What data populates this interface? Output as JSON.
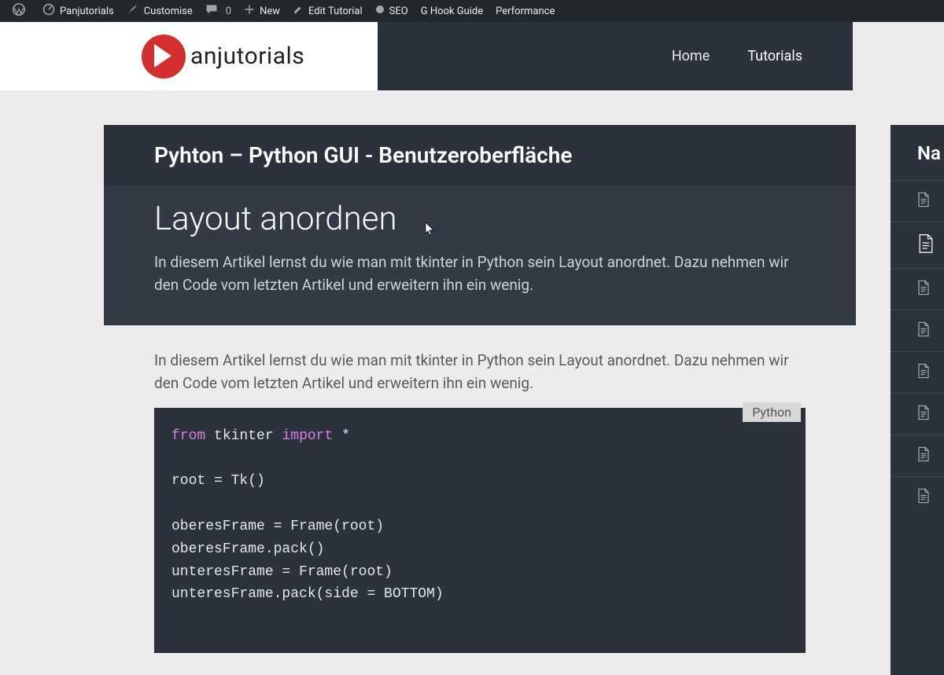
{
  "adminbar": {
    "site": "Panjutorials",
    "customise": "Customise",
    "comments_count": "0",
    "new": "New",
    "edit_tutorial": "Edit Tutorial",
    "seo": "SEO",
    "hook_guide": "G Hook Guide",
    "performance": "Performance"
  },
  "brand": {
    "word": "anjutorials"
  },
  "nav": {
    "home": "Home",
    "tutorials": "Tutorials"
  },
  "course": {
    "title": "Pyhton – Python GUI - Benutzeroberfläche"
  },
  "lesson": {
    "title": "Layout anordnen",
    "summary": "In diesem Artikel lernst du wie man mit tkinter in Python sein Layout anordnet. Dazu nehmen wir den Code vom letzten Artikel und erweitern ihn ein wenig."
  },
  "article": {
    "intro": "In diesem Artikel lernst du wie man mit tkinter in Python sein Layout anordnet. Dazu nehmen wir den Code vom letzten Artikel und erweitern ihn ein wenig."
  },
  "code": {
    "language_badge": "Python",
    "lines": [
      [
        [
          "kw",
          "from"
        ],
        [
          "sp",
          " "
        ],
        [
          "id",
          "tkinter"
        ],
        [
          "sp",
          " "
        ],
        [
          "kw",
          "import"
        ],
        [
          "sp",
          " "
        ],
        [
          "id",
          "*"
        ]
      ],
      [],
      [
        [
          "id",
          "root = Tk()"
        ]
      ],
      [],
      [
        [
          "id",
          "oberesFrame = Frame(root)"
        ]
      ],
      [
        [
          "id",
          "oberesFrame.pack()"
        ]
      ],
      [
        [
          "id",
          "unteresFrame = Frame(root)"
        ]
      ],
      [
        [
          "id",
          "unteresFrame.pack(side = BOTTOM)"
        ]
      ]
    ]
  },
  "sidebar": {
    "title_fragment": "Na",
    "items_count": 8,
    "active_index": 1
  }
}
